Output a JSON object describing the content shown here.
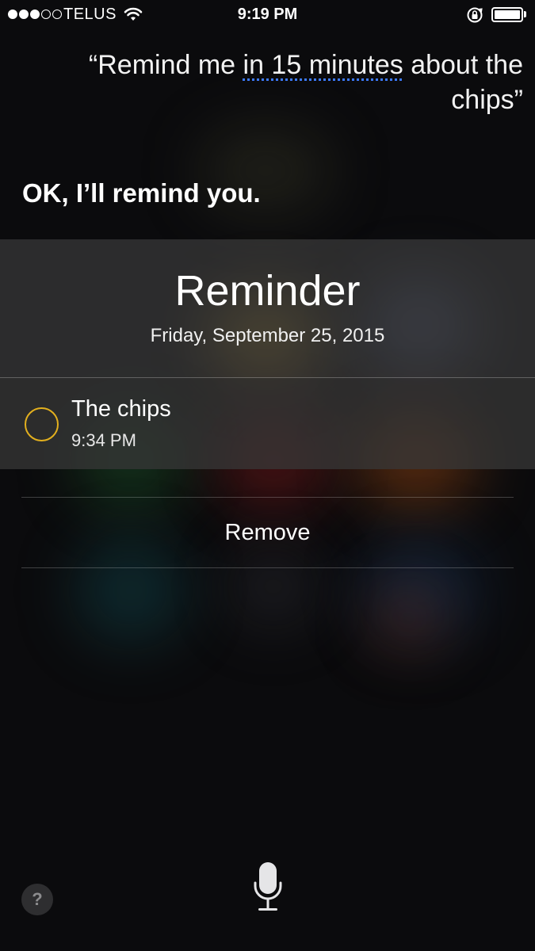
{
  "status_bar": {
    "carrier": "TELUS",
    "time": "9:19 PM",
    "signal_bars_filled": 3,
    "signal_bars_total": 5,
    "wifi_icon": "wifi-icon",
    "rotation_lock_icon": "rotation-lock-icon",
    "battery_icon": "battery-icon"
  },
  "conversation": {
    "query_open": "“Remind me ",
    "query_highlight": "in 15 minutes",
    "query_rest": " about the chips”",
    "response": "OK, I’ll remind you."
  },
  "reminder_card": {
    "title": "Reminder",
    "date": "Friday, September 25, 2015",
    "item_title": "The chips",
    "item_time": "9:34 PM",
    "checkbox_color": "#e3b01e"
  },
  "actions": {
    "remove_label": "Remove"
  },
  "controls": {
    "help_label": "?",
    "microphone_icon": "microphone-icon"
  },
  "colors": {
    "highlight_underline": "#3d7bff",
    "background": "#0b0b0d"
  }
}
